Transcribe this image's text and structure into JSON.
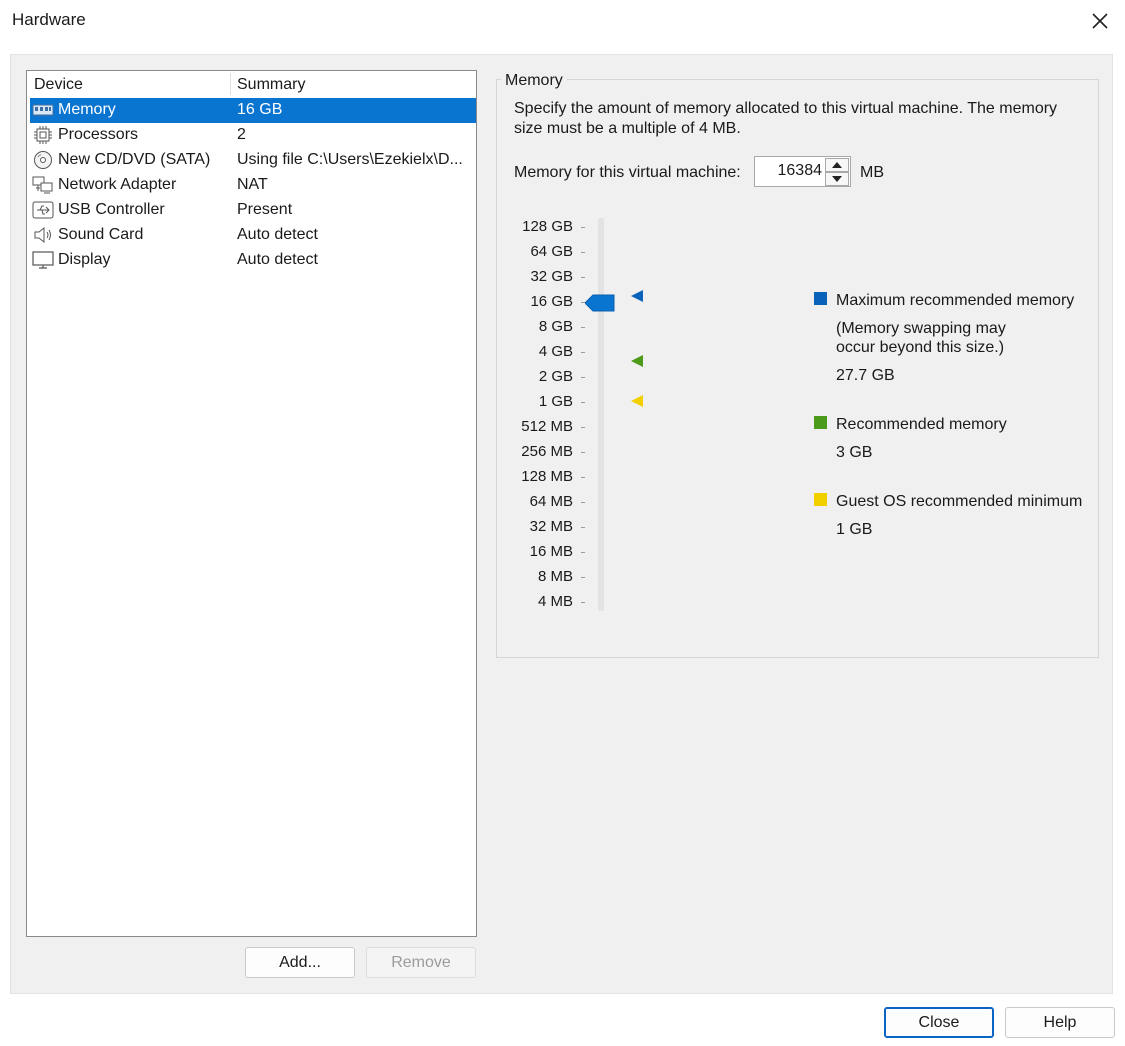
{
  "window": {
    "title": "Hardware"
  },
  "device_list": {
    "columns": [
      "Device",
      "Summary"
    ],
    "rows": [
      {
        "device": "Memory",
        "summary": "16 GB",
        "icon": "memory-icon",
        "selected": true
      },
      {
        "device": "Processors",
        "summary": "2",
        "icon": "processor-icon"
      },
      {
        "device": "New CD/DVD (SATA)",
        "summary": "Using file C:\\Users\\Ezekielx\\D...",
        "icon": "cd-dvd-icon"
      },
      {
        "device": "Network Adapter",
        "summary": "NAT",
        "icon": "network-adapter-icon"
      },
      {
        "device": "USB Controller",
        "summary": "Present",
        "icon": "usb-icon"
      },
      {
        "device": "Sound Card",
        "summary": "Auto detect",
        "icon": "speaker-icon"
      },
      {
        "device": "Display",
        "summary": "Auto detect",
        "icon": "monitor-icon"
      }
    ],
    "add_label": "Add...",
    "remove_label": "Remove"
  },
  "memory": {
    "group_label": "Memory",
    "description": "Specify the amount of memory allocated to this virtual machine. The memory size must be a multiple of 4 MB.",
    "field_label": "Memory for this virtual machine:",
    "value": "16384",
    "unit": "MB",
    "scale_labels": [
      "128 GB",
      "64 GB",
      "32 GB",
      "16 GB",
      "8 GB",
      "4 GB",
      "2 GB",
      "1 GB",
      "512 MB",
      "256 MB",
      "128 MB",
      "64 MB",
      "32 MB",
      "16 MB",
      "8 MB",
      "4 MB"
    ],
    "slider_value_index": 3,
    "markers": [
      {
        "name": "max",
        "index": 2.8,
        "color": "#0a63b8"
      },
      {
        "name": "recommended",
        "index": 5.4,
        "color": "#4c9a1a"
      },
      {
        "name": "min",
        "index": 7.0,
        "color": "#f2d000"
      }
    ],
    "legend": {
      "max_label": "Maximum recommended memory",
      "max_note_1": "(Memory swapping may",
      "max_note_2": "occur beyond this size.)",
      "max_value": "27.7 GB",
      "rec_label": "Recommended memory",
      "rec_value": "3 GB",
      "min_label": "Guest OS recommended minimum",
      "min_value": "1 GB",
      "colors": {
        "max": "#0a63b8",
        "recommended": "#4c9a1a",
        "min": "#f2d000"
      }
    }
  },
  "footer": {
    "close_label": "Close",
    "help_label": "Help"
  }
}
